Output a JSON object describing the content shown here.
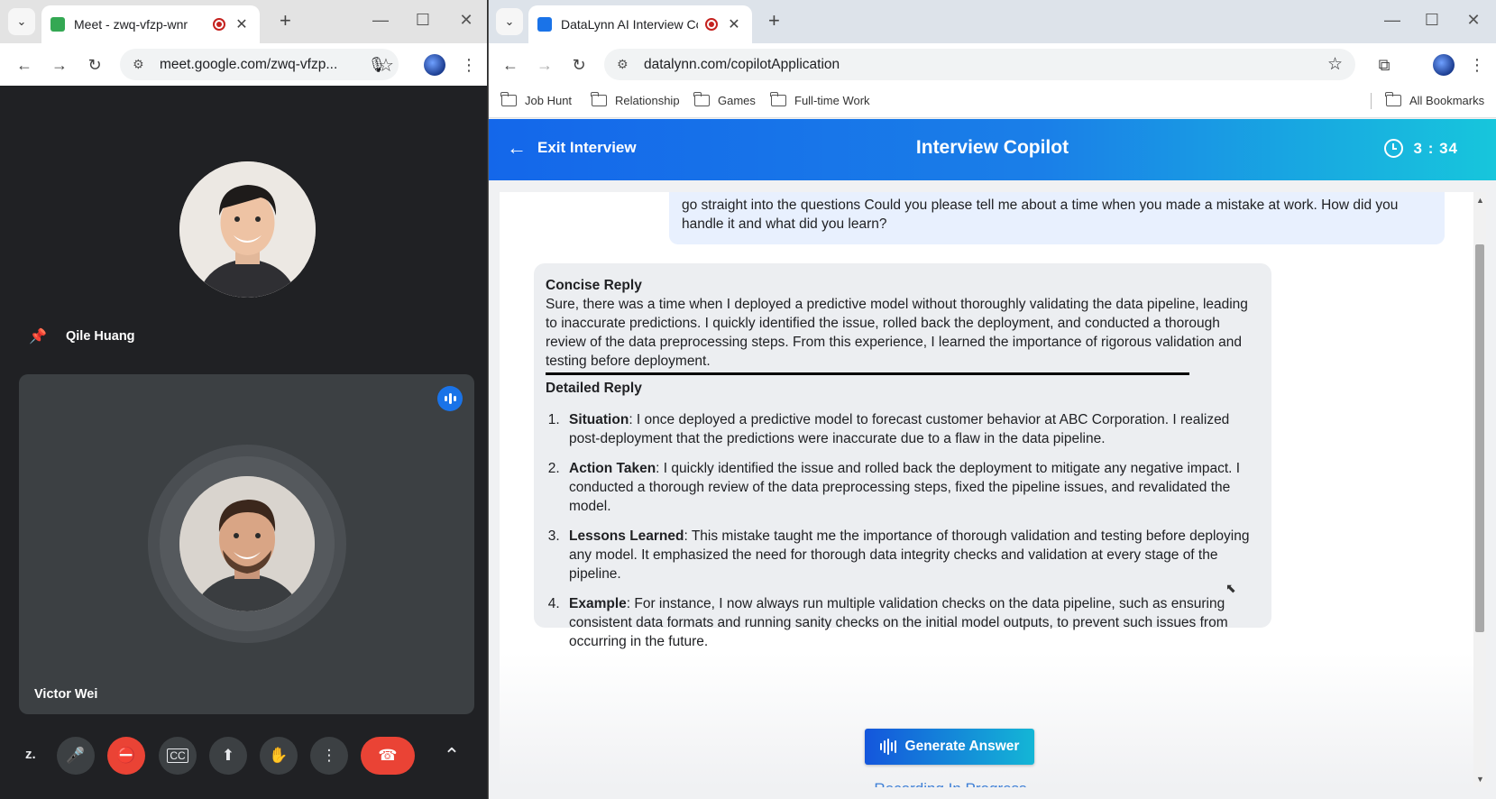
{
  "left_window": {
    "tab": {
      "title": "Meet - zwq-vfzp-wnr",
      "favicon_color": "#34a853"
    },
    "omnibox": {
      "url": "meet.google.com/zwq-vfzp..."
    },
    "meet": {
      "self_name": "Qile Huang",
      "guest_name": "Victor Wei",
      "z_label": "z."
    }
  },
  "right_window": {
    "tab": {
      "title": "DataLynn AI Interview Copilo",
      "favicon_color": "#1a73e8"
    },
    "omnibox": {
      "url": "datalynn.com/copilotApplication"
    },
    "bookmarks": [
      "Job Hunt",
      "Relationship",
      "Games",
      "Full-time Work"
    ],
    "all_bookmarks": "All Bookmarks",
    "app": {
      "exit_label": "Exit Interview",
      "title": "Interview Copilot",
      "timer": "3 : 34",
      "question": "go straight into the questions Could you please tell me about a time when you made a mistake at work. How did you handle it and what did you learn?",
      "concise_heading": "Concise Reply",
      "concise_text": "Sure, there was a time when I deployed a predictive model without thoroughly validating the data pipeline, leading to inaccurate predictions. I quickly identified the issue, rolled back the deployment, and conducted a thorough review of the data preprocessing steps. From this experience, I learned the importance of rigorous validation and testing before deployment.",
      "detailed_heading": "Detailed Reply",
      "detailed_items": [
        {
          "label": "Situation",
          "text": ": I once deployed a predictive model to forecast customer behavior at ABC Corporation. I realized post-deployment that the predictions were inaccurate due to a flaw in the data pipeline."
        },
        {
          "label": "Action Taken",
          "text": ": I quickly identified the issue and rolled back the deployment to mitigate any negative impact. I conducted a thorough review of the data preprocessing steps, fixed the pipeline issues, and revalidated the model."
        },
        {
          "label": "Lessons Learned",
          "text": ": This mistake taught me the importance of thorough validation and testing before deploying any model. It emphasized the need for thorough data integrity checks and validation at every stage of the pipeline."
        },
        {
          "label": "Example",
          "text": ": For instance, I now always run multiple validation checks on the data pipeline, such as ensuring consistent data formats and running sanity checks on the initial model outputs, to prevent such issues from occurring in the future."
        }
      ],
      "generate_label": "Generate Answer",
      "recording_status": "Recording In Progress"
    }
  },
  "colors": {
    "header_start": "#1467ea",
    "header_end": "#17c6dc",
    "end_call": "#ea4335",
    "recording_text": "#3d7fd6"
  }
}
